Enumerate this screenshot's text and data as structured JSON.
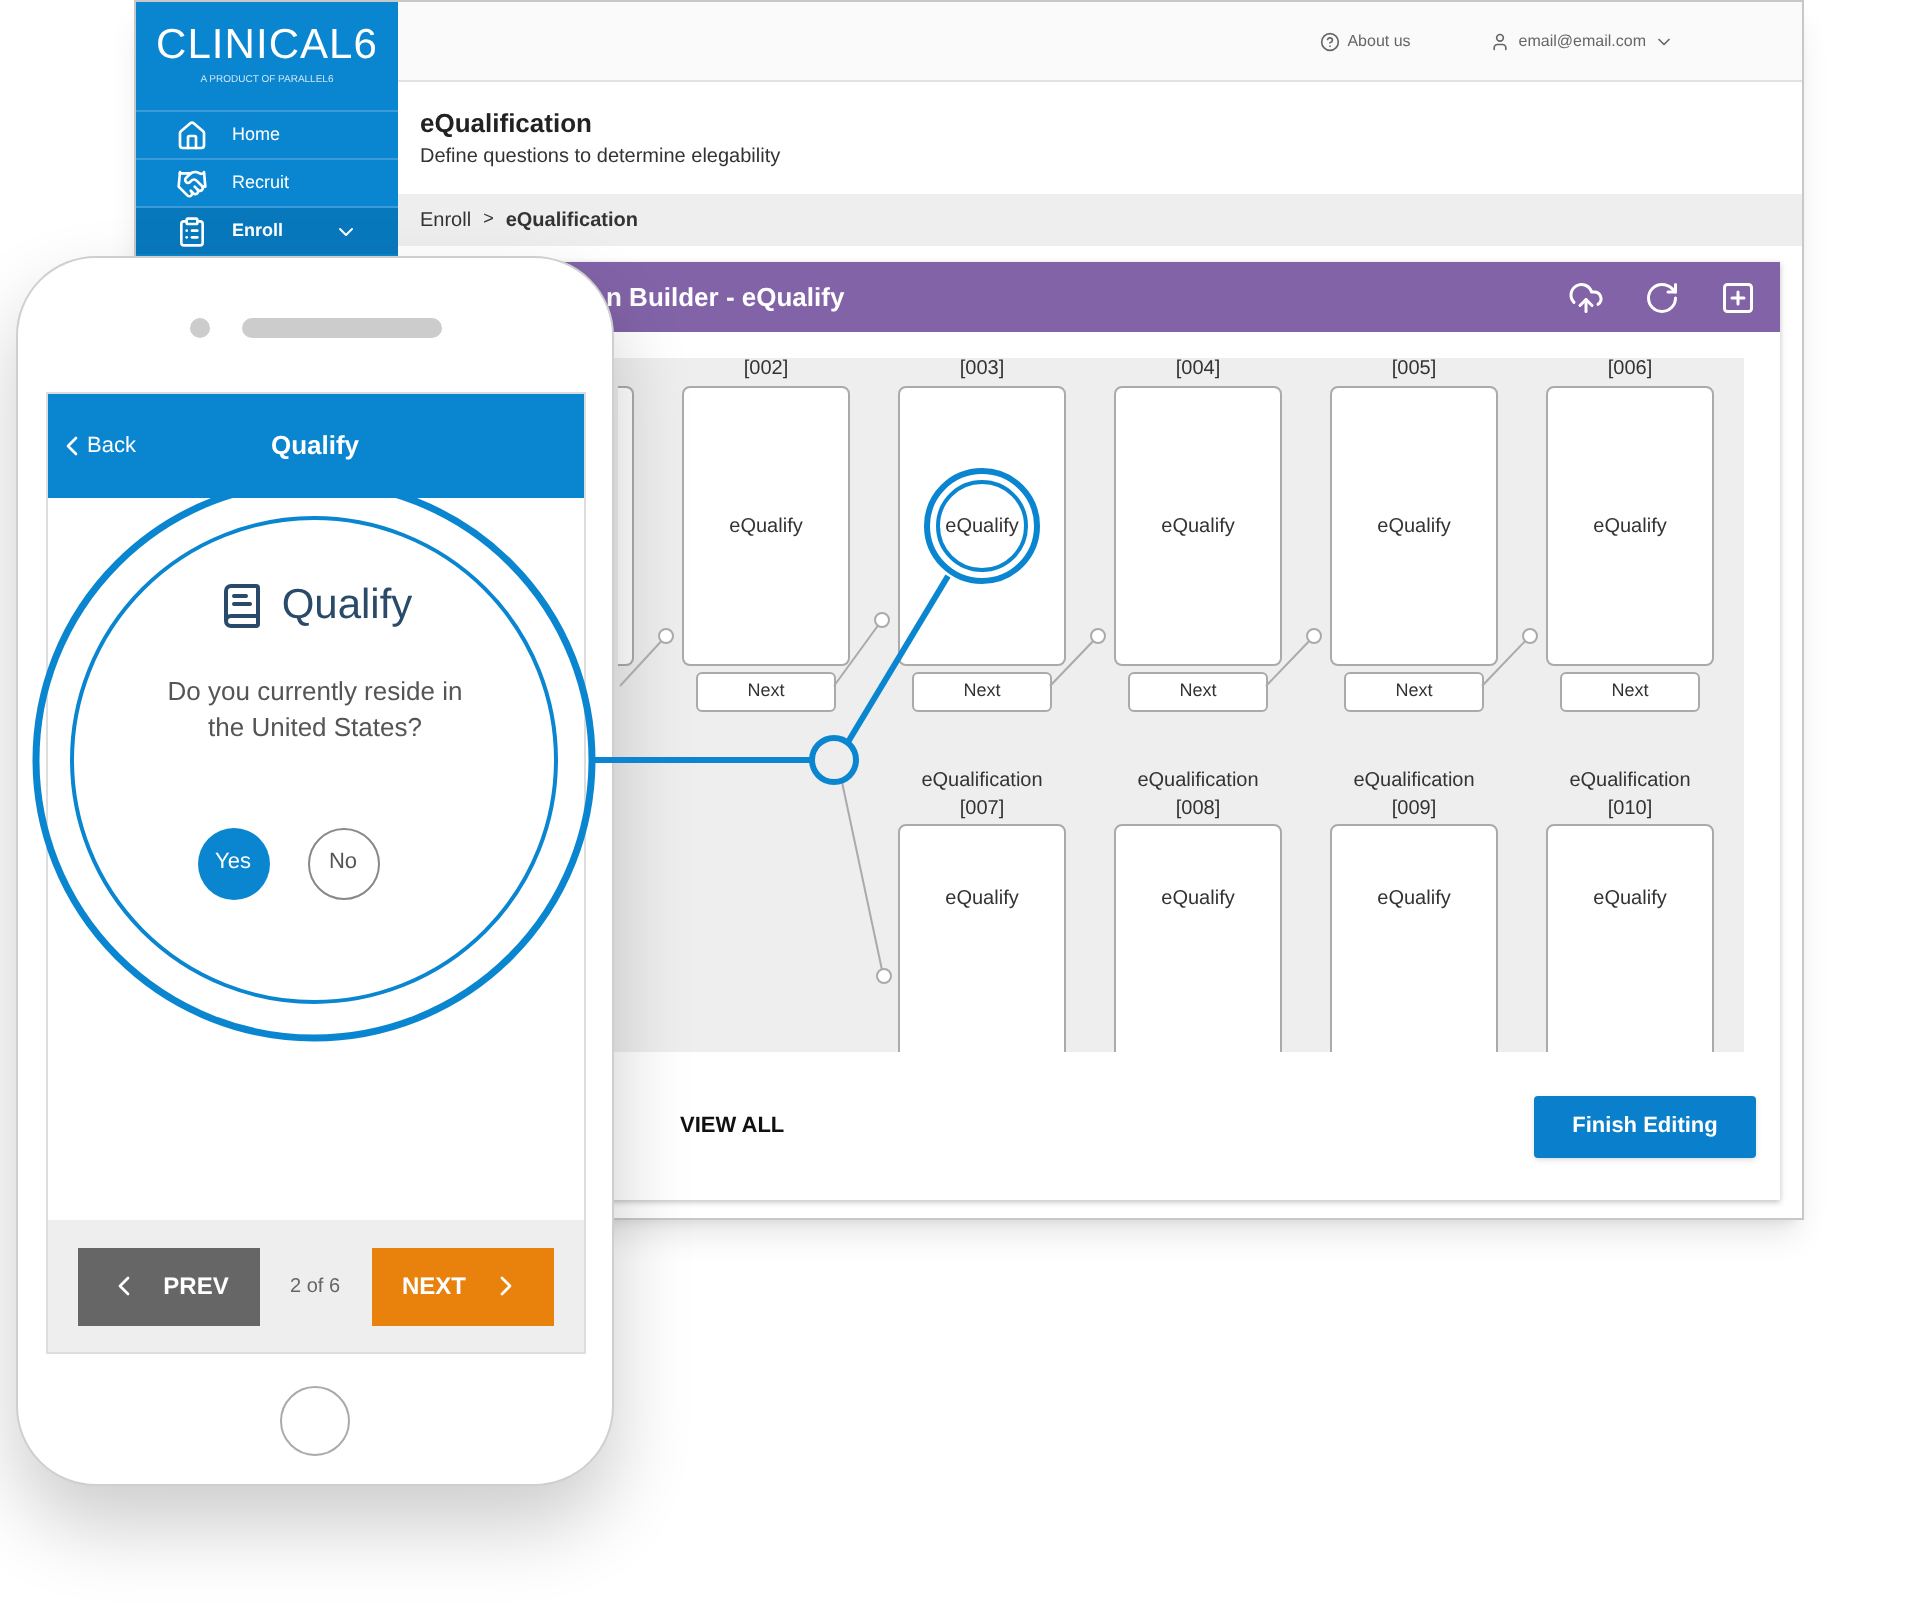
{
  "sidebar": {
    "logo": "CLINICAL6",
    "tagline": "A PRODUCT OF PARALLEL6",
    "items": [
      {
        "kind": "home",
        "label": "Home",
        "selected": false,
        "submenu": false
      },
      {
        "kind": "recruit",
        "label": "Recruit",
        "selected": false,
        "submenu": false
      },
      {
        "kind": "enroll",
        "label": "Enroll",
        "selected": true,
        "submenu": true
      }
    ]
  },
  "topbar": {
    "links": [
      {
        "kind": "help",
        "label": "About us"
      },
      {
        "kind": "user",
        "label": "email@email.com"
      }
    ]
  },
  "header": {
    "title": "eQualification",
    "subtitle": "Define questions to determine elegability"
  },
  "breadcrumb": {
    "separator": ">",
    "items": [
      {
        "label": "Enroll",
        "current": false
      },
      {
        "label": "eQualification",
        "current": true
      }
    ]
  },
  "builder": {
    "title": "n Builder - eQualify",
    "top_row": [
      {
        "label": "[002]",
        "body": "eQualify",
        "button": "Next",
        "highlighted": false
      },
      {
        "label": "[003]",
        "body": "eQualify",
        "button": "Next",
        "highlighted": true
      },
      {
        "label": "[004]",
        "body": "eQualify",
        "button": "Next",
        "highlighted": false
      },
      {
        "label": "[005]",
        "body": "eQualify",
        "button": "Next",
        "highlighted": false
      },
      {
        "label": "[006]",
        "body": "eQualify",
        "button": "Next",
        "highlighted": false
      }
    ],
    "bottom_row": [
      {
        "title": "eQualification",
        "label": "[007]",
        "body": "eQualify"
      },
      {
        "title": "eQualification",
        "label": "[008]",
        "body": "eQualify"
      },
      {
        "title": "eQualification",
        "label": "[009]",
        "body": "eQualify"
      },
      {
        "title": "eQualification",
        "label": "[010]",
        "body": "eQualify"
      }
    ],
    "view_all": "VIEW ALL",
    "finish_button": "Finish Editing"
  },
  "phone": {
    "back": "Back",
    "title": "Qualify",
    "heading": "Qualify",
    "question": "Do you currently reside in the United States?",
    "options": [
      {
        "label": "Yes",
        "selected": true
      },
      {
        "label": "No",
        "selected": false
      }
    ],
    "prev": "PREV",
    "page": "2 of 6",
    "next": "NEXT"
  }
}
